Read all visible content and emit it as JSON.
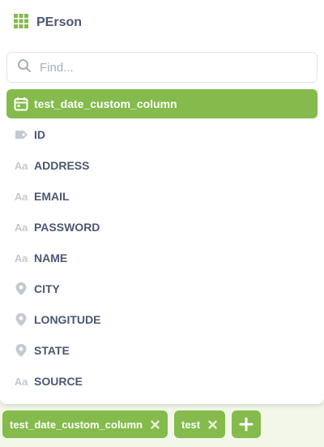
{
  "header": {
    "title": "PErson",
    "icon": "table-grid-icon"
  },
  "search": {
    "placeholder": "Find...",
    "value": ""
  },
  "columns": [
    {
      "label": "test_date_custom_column",
      "icon": "calendar-icon",
      "selected": true
    },
    {
      "label": "ID",
      "icon": "tag-icon",
      "selected": false
    },
    {
      "label": "ADDRESS",
      "icon": "text-aa-icon",
      "selected": false
    },
    {
      "label": "EMAIL",
      "icon": "text-aa-icon",
      "selected": false
    },
    {
      "label": "PASSWORD",
      "icon": "text-aa-icon",
      "selected": false
    },
    {
      "label": "NAME",
      "icon": "text-aa-icon",
      "selected": false
    },
    {
      "label": "CITY",
      "icon": "location-pin-icon",
      "selected": false
    },
    {
      "label": "LONGITUDE",
      "icon": "location-pin-icon",
      "selected": false
    },
    {
      "label": "STATE",
      "icon": "location-pin-icon",
      "selected": false
    },
    {
      "label": "SOURCE",
      "icon": "text-aa-icon",
      "selected": false
    }
  ],
  "aa_glyph": "Aa",
  "footer": {
    "chips": [
      {
        "label": "test_date_custom_column"
      },
      {
        "label": "test"
      }
    ]
  },
  "colors": {
    "accent": "#84bb4c",
    "text": "#4c5773",
    "muted_icon": "#c3c9d1",
    "background_tint": "#f2f7ea"
  }
}
